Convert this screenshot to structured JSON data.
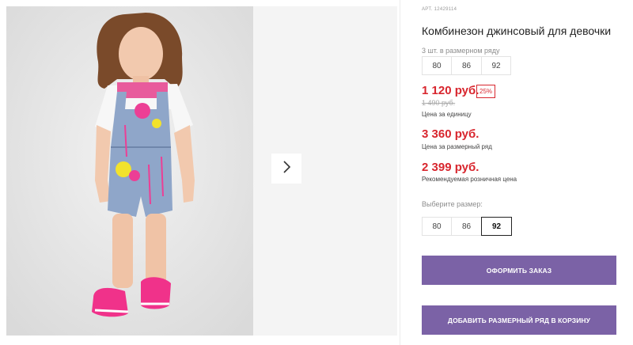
{
  "product": {
    "sku": "АРТ. 12429114",
    "title": "Комбинезон джинсовый для девочки"
  },
  "size_row": {
    "hint": "3 шт. в размерном ряду",
    "sizes": [
      "80",
      "86",
      "92"
    ]
  },
  "pricing": {
    "unit_price": "1 120 руб.",
    "discount": "25%",
    "old_price": "1 490 руб.",
    "unit_caption": "Цена за единицу",
    "row_price": "3 360 руб.",
    "row_caption": "Цена за размерный ряд",
    "retail_price": "2 399 руб.",
    "retail_caption": "Рекомендуемая розничная цена"
  },
  "size_picker": {
    "hint": "Выберите размер:",
    "sizes": [
      "80",
      "86",
      "92"
    ],
    "selected": "92"
  },
  "actions": {
    "order_label": "Оформить заказ",
    "add_row_label": "Добавить размерный ряд в корзину"
  },
  "colors": {
    "accent": "#7b62a6",
    "price": "#d8262e"
  },
  "icons": {
    "gallery_next": "chevron-right-icon"
  }
}
